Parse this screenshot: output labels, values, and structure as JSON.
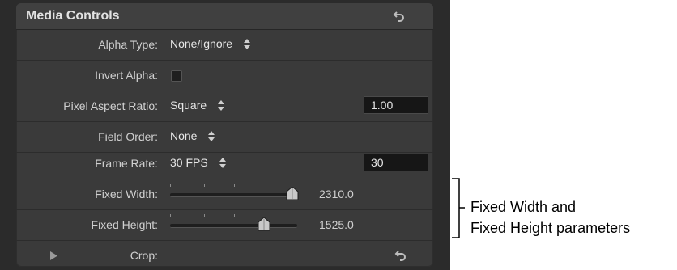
{
  "panel": {
    "title": "Media Controls",
    "header_reset_icon": "reset-icon"
  },
  "rows": {
    "alpha_type": {
      "label": "Alpha Type:",
      "value": "None/Ignore",
      "icon": "updown-arrows-icon"
    },
    "invert_alpha": {
      "label": "Invert Alpha:",
      "checked": false
    },
    "pixel_aspect_ratio": {
      "label": "Pixel Aspect Ratio:",
      "value": "Square",
      "field_value": "1.00",
      "icon": "updown-arrows-icon"
    },
    "field_order": {
      "label": "Field Order:",
      "value": "None",
      "icon": "updown-arrows-icon"
    },
    "frame_rate": {
      "label": "Frame Rate:",
      "value": "30 FPS",
      "field_value": "30",
      "icon": "updown-arrows-icon"
    },
    "fixed_width": {
      "label": "Fixed Width:",
      "value": "2310.0",
      "slider_level": 0.96
    },
    "fixed_height": {
      "label": "Fixed Height:",
      "value": "1525.0",
      "slider_level": 0.74
    },
    "crop": {
      "label": "Crop:",
      "disclosure_icon": "disclosure-triangle-icon",
      "reset_icon": "reset-icon"
    }
  },
  "annotation": {
    "line1": "Fixed Width and",
    "line2": "Fixed Height parameters"
  },
  "colors": {
    "panel_bg": "#3a3a3a",
    "outer_bg": "#2b2b2b",
    "field_bg": "#161616",
    "text": "#d0d0d0"
  }
}
